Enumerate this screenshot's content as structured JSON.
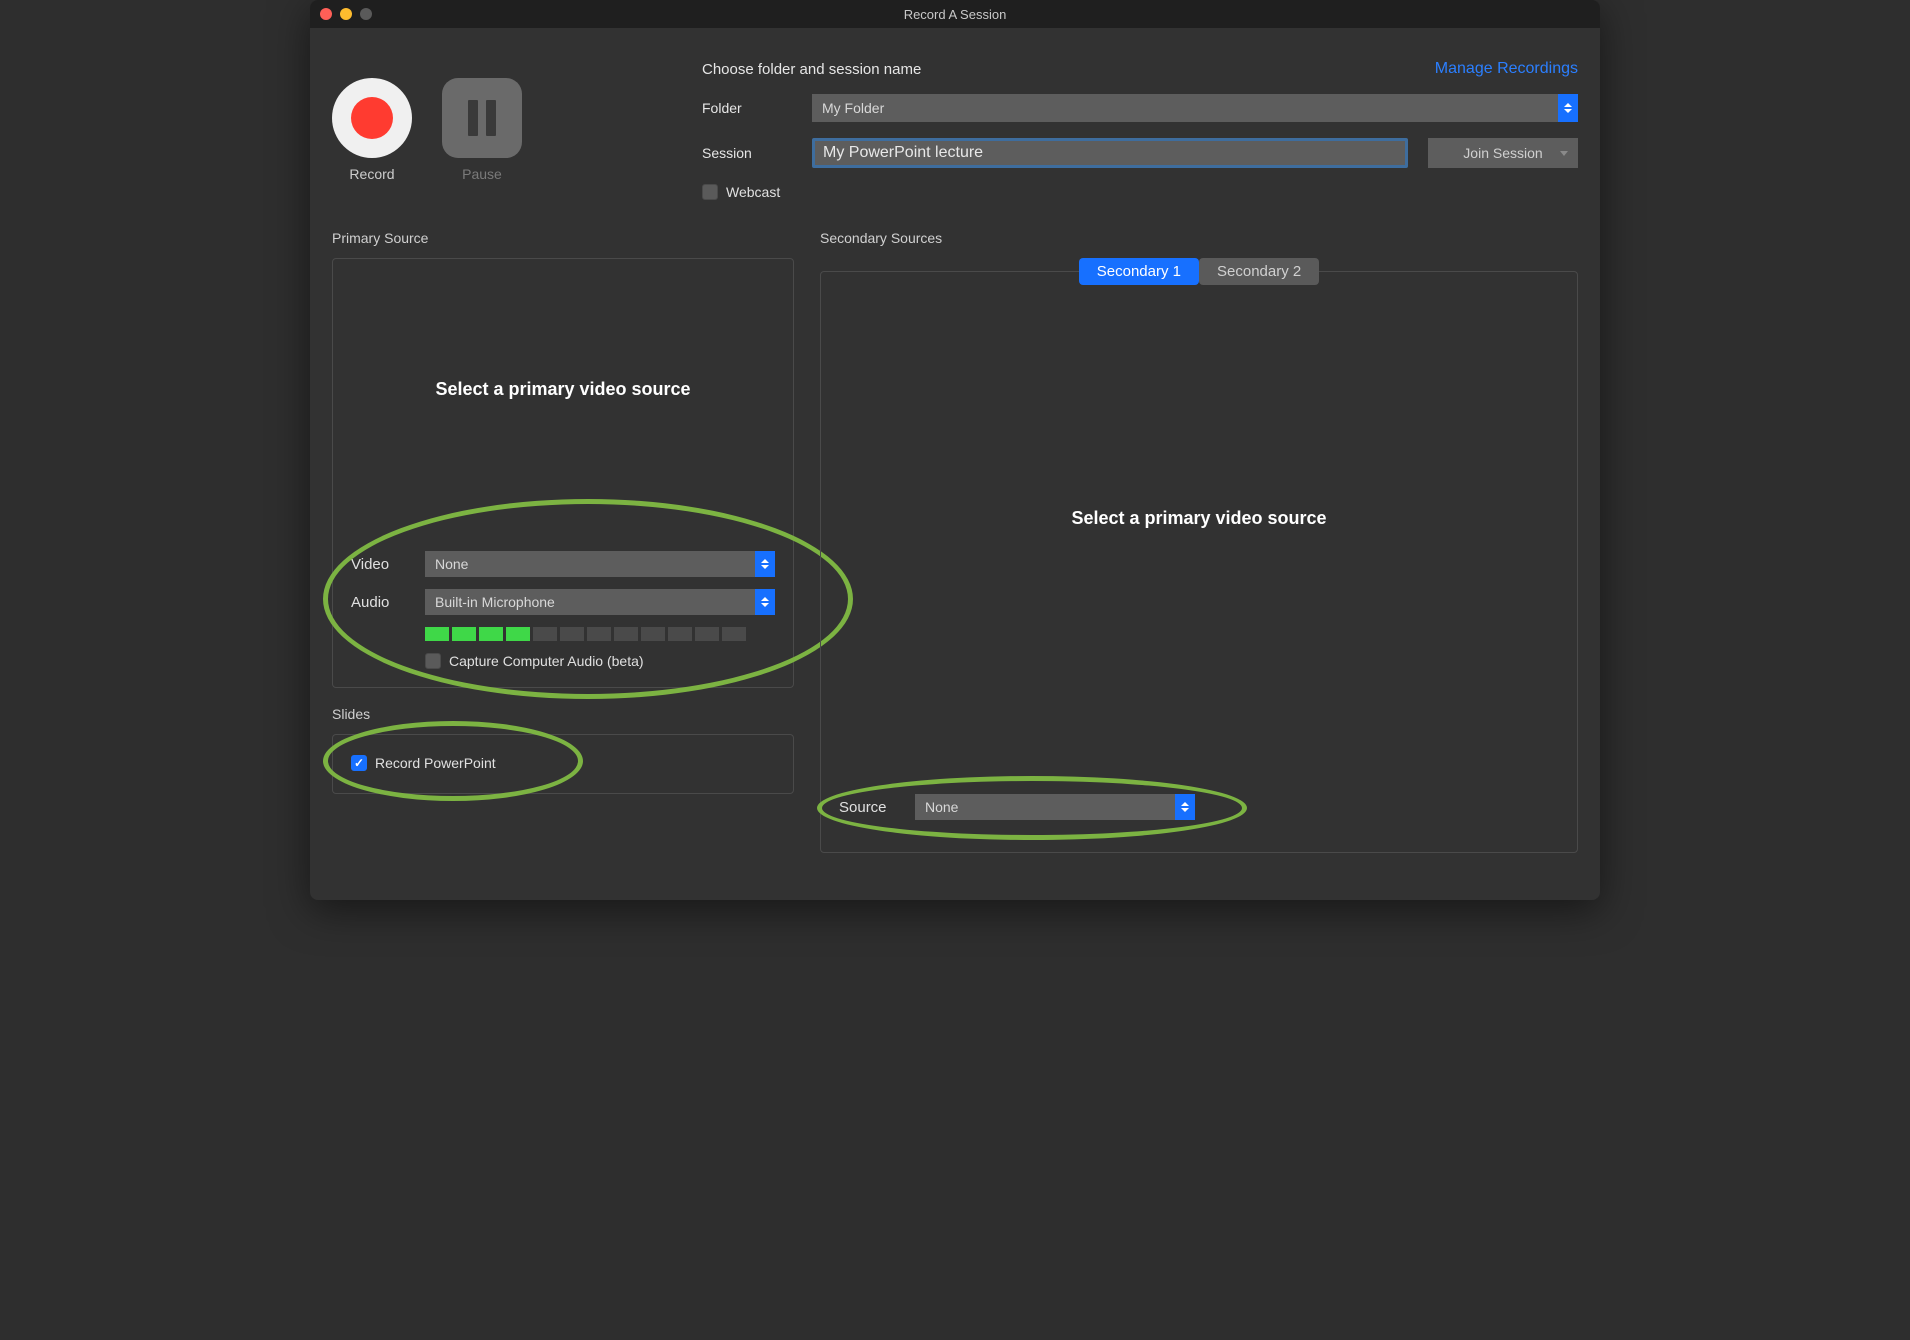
{
  "window": {
    "title": "Record A Session"
  },
  "controls": {
    "record_label": "Record",
    "pause_label": "Pause"
  },
  "setup": {
    "header": "Choose folder and session name",
    "manage_link": "Manage Recordings",
    "folder_label": "Folder",
    "folder_value": "My Folder",
    "session_label": "Session",
    "session_value": "My PowerPoint lecture",
    "join_label": "Join Session",
    "webcast_label": "Webcast"
  },
  "primary": {
    "title": "Primary Source",
    "prompt": "Select a primary video source",
    "video_label": "Video",
    "video_value": "None",
    "audio_label": "Audio",
    "audio_value": "Built-in Microphone",
    "level_segments": 12,
    "level_active": 4,
    "capture_label": "Capture Computer Audio (beta)"
  },
  "slides": {
    "title": "Slides",
    "record_ppt_label": "Record PowerPoint",
    "record_ppt_checked": true
  },
  "secondary": {
    "title": "Secondary Sources",
    "tab1": "Secondary 1",
    "tab2": "Secondary 2",
    "prompt": "Select a primary video source",
    "source_label": "Source",
    "source_value": "None"
  }
}
